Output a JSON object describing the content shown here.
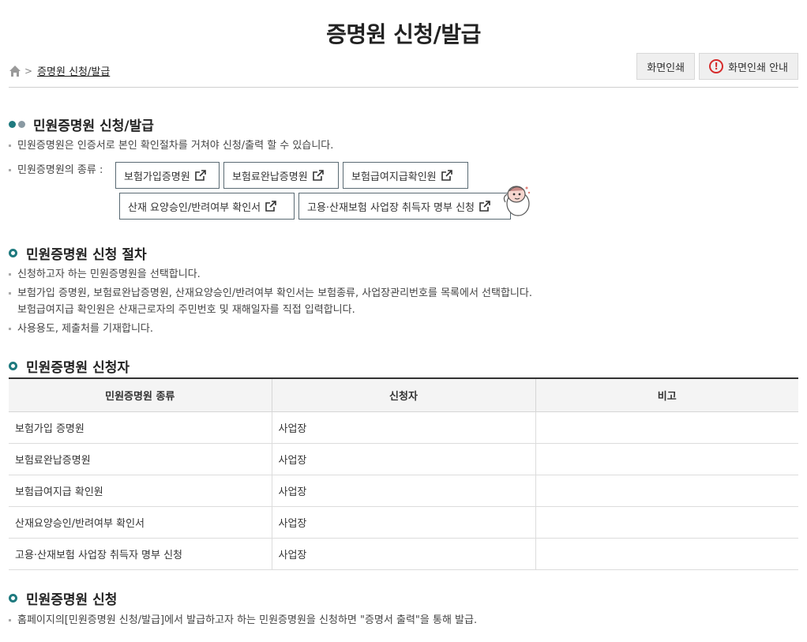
{
  "page": {
    "title": "증명원 신청/발급"
  },
  "breadcrumb": {
    "home_icon": "home-icon",
    "current": "증명원 신청/발급"
  },
  "tools": {
    "print": "화면인쇄",
    "print_guide": "화면인쇄 안내",
    "print_guide_icon": "exclamation-circle-icon"
  },
  "section1": {
    "title": "민원증명원 신청/발급",
    "desc": "민원증명원은 인증서로 본인 확인절차를 거쳐야 신청/출력 할 수 있습니다.",
    "types_label": "민원증명원의 종류 :",
    "docs": [
      "보험가입증명원",
      "보험료완납증명원",
      "보험급여지급확인원",
      "산재 요양승인/반려여부 확인서",
      "고용·산재보험 사업장 취득자 명부 신청"
    ]
  },
  "section2": {
    "title": "민원증명원 신청 절차",
    "steps": [
      "신청하고자 하는 민원증명원을 선택합니다.",
      "보험가입 증명원, 보험료완납증명원, 산재요양승인/반려여부 확인서는 보험종류, 사업장관리번호를 목록에서 선택합니다.",
      "보험급여지급 확인원은 산재근로자의 주민번호 및 재해일자를 직접 입력합니다.",
      "사용용도, 제출처를 기재합니다."
    ]
  },
  "section3": {
    "title": "민원증명원 신청자",
    "headers": [
      "민원증명원 종류",
      "신청자",
      "비고"
    ],
    "rows": [
      [
        "보험가입 증명원",
        "사업장",
        ""
      ],
      [
        "보험료완납증명원",
        "사업장",
        ""
      ],
      [
        "보험급여지급 확인원",
        "사업장",
        ""
      ],
      [
        "산재요양승인/반려여부 확인서",
        "사업장",
        ""
      ],
      [
        "고용·산재보험 사업장 취득자 명부 신청",
        "사업장",
        ""
      ]
    ]
  },
  "section4": {
    "title": "민원증명원 신청",
    "desc": "홈페이지의[민원증명원 신청/발급]에서 발급하고자 하는 민원증명원을 신청하면 \"증명서 출력\"을 통해 발급."
  },
  "colors": {
    "accent": "#1f7a7f",
    "warn": "#d62b2b"
  }
}
